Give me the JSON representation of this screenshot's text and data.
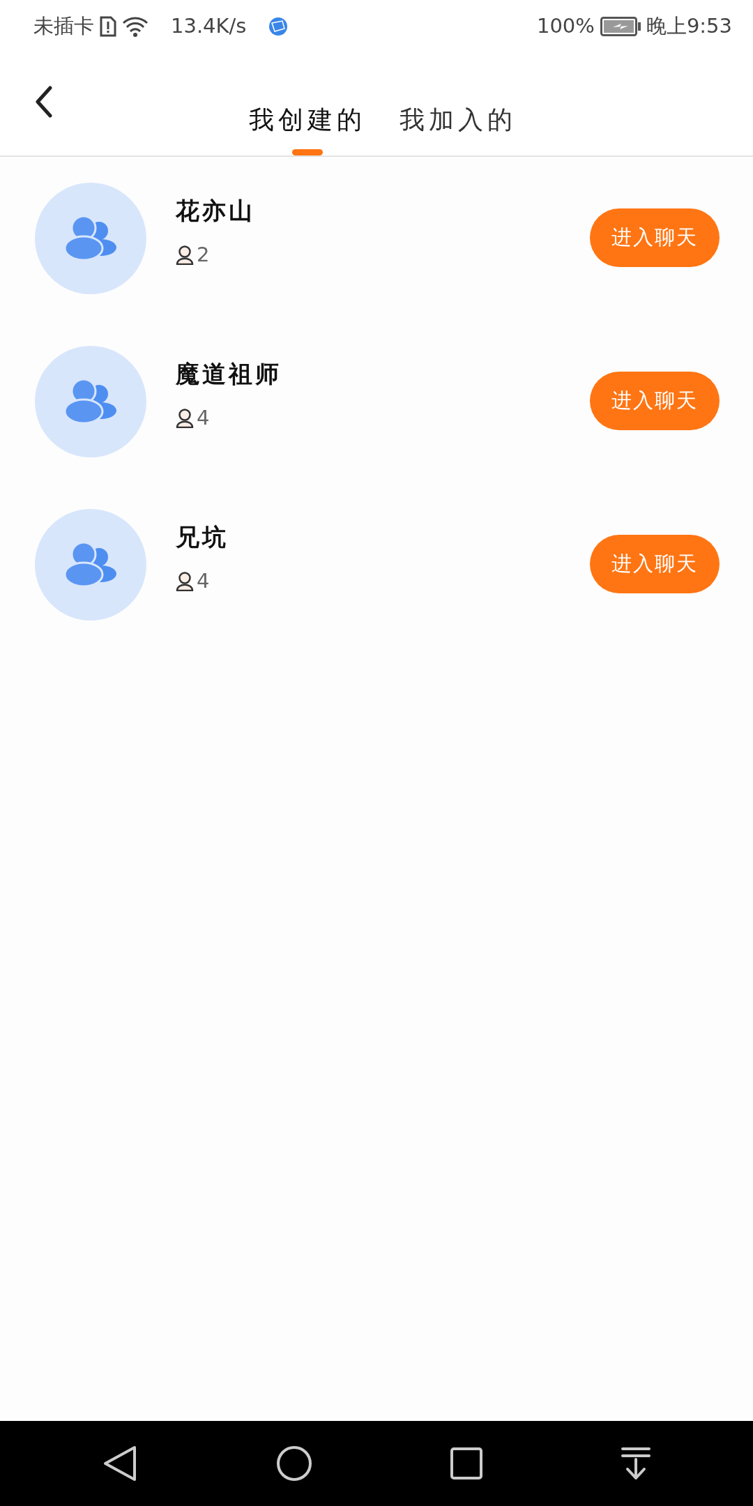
{
  "status_bar": {
    "carrier": "未插卡",
    "speed": "13.4K/s",
    "battery": "100%",
    "time": "晚上9:53"
  },
  "tabs": [
    {
      "label": "我创建的",
      "selected": true
    },
    {
      "label": "我加入的",
      "selected": false
    }
  ],
  "groups": [
    {
      "name": "花亦山",
      "members": "2",
      "button": "进入聊天"
    },
    {
      "name": "魔道祖师",
      "members": "4",
      "button": "进入聊天"
    },
    {
      "name": "兄坑",
      "members": "4",
      "button": "进入聊天"
    }
  ]
}
